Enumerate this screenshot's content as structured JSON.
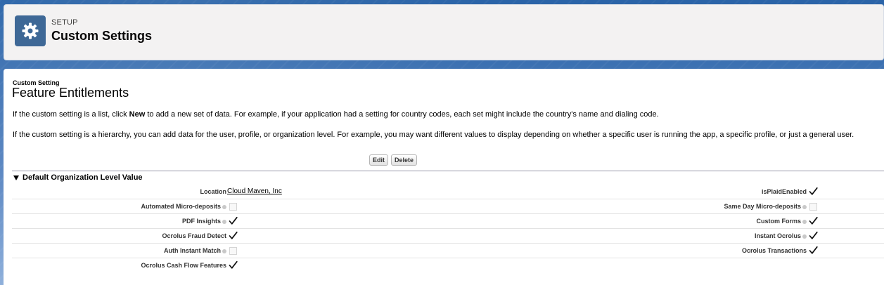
{
  "header": {
    "eyebrow": "SETUP",
    "title": "Custom Settings",
    "icon": "gear-icon"
  },
  "main": {
    "type_label": "Custom Setting",
    "title": "Feature Entitlements",
    "desc1_pre": "If the custom setting is a list, click ",
    "desc1_bold": "New",
    "desc1_post": " to add a new set of data. For example, if your application had a setting for country codes, each set might include the country's name and dialing code.",
    "desc2": "If the custom setting is a hierarchy, you can add data for the user, profile, or organization level. For example, you may want different values to display depending on whether a specific user is running the app, a specific profile, or just a general user.",
    "buttons": {
      "edit": "Edit",
      "delete": "Delete"
    },
    "section_title": "Default Organization Level Value",
    "fields": {
      "location": {
        "label": "Location",
        "value": "Cloud Maven, Inc"
      },
      "is_plaid_enabled": {
        "label": "isPlaidEnabled",
        "checked": true
      },
      "automated_micro_deposits": {
        "label": "Automated Micro-deposits",
        "checked": false
      },
      "same_day_micro_deposits": {
        "label": "Same Day Micro-deposits",
        "checked": false
      },
      "pdf_insights": {
        "label": "PDF Insights",
        "checked": true
      },
      "custom_forms": {
        "label": "Custom Forms",
        "checked": true
      },
      "ocrolus_fraud_detect": {
        "label": "Ocrolus Fraud Detect",
        "checked": true
      },
      "instant_ocrolus": {
        "label": "Instant Ocrolus",
        "checked": true
      },
      "auth_instant_match": {
        "label": "Auth Instant Match",
        "checked": false
      },
      "ocrolus_transactions": {
        "label": "Ocrolus Transactions",
        "checked": true
      },
      "ocrolus_cash_flow_features": {
        "label": "Ocrolus Cash Flow Features",
        "checked": true
      }
    }
  }
}
